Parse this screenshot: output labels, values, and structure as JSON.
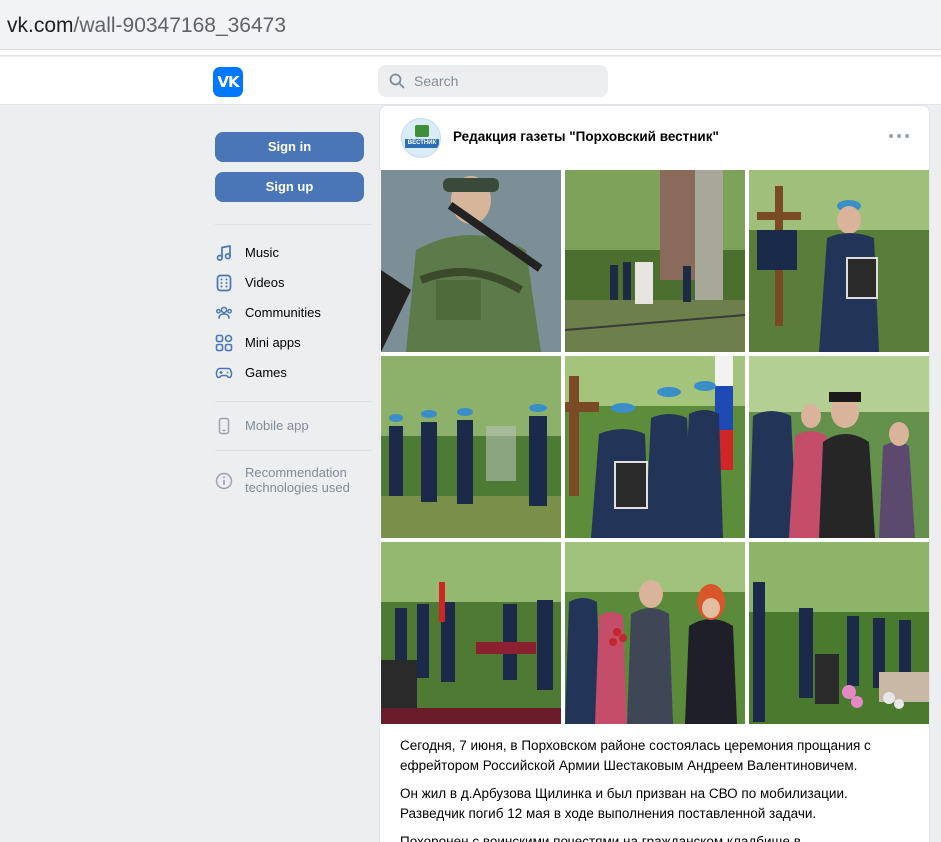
{
  "browser": {
    "url_host": "vk.com",
    "url_path": "/wall-90347168_36473"
  },
  "header": {
    "logo_text": "VK",
    "search_placeholder": "Search"
  },
  "sidebar": {
    "sign_in_label": "Sign in",
    "sign_up_label": "Sign up",
    "items": [
      {
        "label": "Music",
        "icon": "music-icon"
      },
      {
        "label": "Videos",
        "icon": "video-icon"
      },
      {
        "label": "Communities",
        "icon": "communities-icon"
      },
      {
        "label": "Mini apps",
        "icon": "mini-apps-icon"
      },
      {
        "label": "Games",
        "icon": "gamepad-icon"
      }
    ],
    "mobile_app_label": "Mobile app",
    "recommendation_label": "Recommendation technologies used"
  },
  "post": {
    "author": "Редакция газеты \"Порховский вестник\"",
    "avatar_text": "ВЕСТНИК",
    "photos_count": 9,
    "paragraphs": [
      "Сегодня, 7 июня, в Порховском районе состоялась церемония прощания с ефрейтором Российской Армии Шестаковым Андреем Валентиновичем.",
      "Он жил в д.Арбузова Щилинка и был призван на СВО по мобилизации. Разведчик погиб 12 мая в ходе выполнения поставленной задачи.",
      "Похоронен с воинскими почестями на гражданском кладбище в"
    ]
  },
  "colors": {
    "brand": "#0077ff",
    "button": "#4a76b8",
    "page_bg": "#edeef0",
    "nav_icon": "#4a76b8"
  }
}
